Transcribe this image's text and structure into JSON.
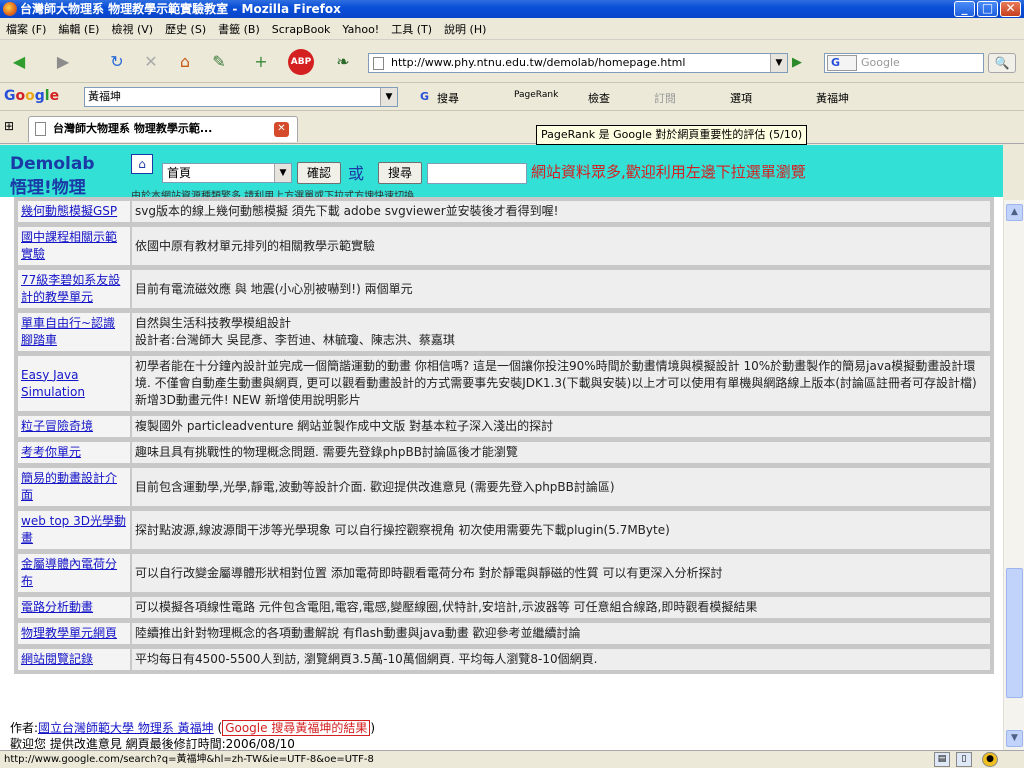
{
  "window": {
    "title": "台灣師大物理系 物理教學示範實驗教室 - Mozilla Firefox",
    "min": "_",
    "max": "□",
    "close": "✕"
  },
  "menu": [
    "檔案 (F)",
    "編輯 (E)",
    "檢視 (V)",
    "歷史 (S)",
    "書籤 (B)",
    "ScrapBook",
    "Yahoo!",
    "工具 (T)",
    "說明 (H)"
  ],
  "nav": {
    "url": "http://www.phy.ntnu.edu.tw/demolab/homepage.html",
    "search_engine": "G",
    "search_placeholder": "Google"
  },
  "google_toolbar": {
    "logo": "Google",
    "query": "黃福坤",
    "search": "搜尋",
    "pagerank": "PageRank",
    "check": "檢查",
    "subscribe": "訂閱",
    "options": "選項",
    "user": "黃福坤"
  },
  "tab": {
    "label": "台灣師大物理系 物理教學示範..."
  },
  "tooltip": "PageRank 是 Google 對於網頁重要性的評估 (5/10)",
  "header": {
    "logo_line1": "Demolab",
    "logo_line2": "悟理!物理",
    "select_value": "首頁",
    "confirm": "確認",
    "or": "或",
    "search": "搜尋",
    "notice": "網站資料眾多,歡迎利用左邊下拉選單瀏覽",
    "sub": "由於本網站資源種類繁多,請利用上方選單或下拉式方塊快速切換"
  },
  "rows": [
    {
      "name": "幾何動態模擬GSP",
      "desc": "svg版本的線上幾何動態模擬 須先下載 adobe svgviewer並安裝後才看得到喔!"
    },
    {
      "name": "國中課程相關示範實驗",
      "desc": "依國中原有教材單元排列的相關教學示範實驗"
    },
    {
      "name": "77級李碧如系友設計的教學單元",
      "desc": "目前有電流磁效應 與 地震(小心別被嚇到!) 兩個單元"
    },
    {
      "name": "單車自由行~認識腳踏車",
      "desc": "自然與生活科技教學模組設計\n設計者:台灣師大 吳昆彥、李哲迪、林毓瓊、陳志洪、蔡嘉琪"
    },
    {
      "name": "Easy Java Simulation",
      "desc": "初學者能在十分鐘內設計並完成一個簡諧運動的動畫 你相信嗎? 這是一個讓你投注90%時間於動畫情境與模擬設計 10%於動畫製作的簡易java模擬動畫設計環境. 不僅會自動產生動畫與網頁, 更可以觀看動畫設計的方式需要事先安裝JDK1.3(下載與安裝)以上才可以使用有單機與網路線上版本(討論區註冊者可存設計檔) 新增3D動畫元件! NEW 新增使用說明影片"
    },
    {
      "name": "粒子冒險奇境",
      "desc": "複製國外 particleadventure 網站並製作成中文版 對基本粒子深入淺出的探討"
    },
    {
      "name": "考考你單元",
      "desc": "趣味且具有挑戰性的物理概念問題. 需要先登錄phpBB討論區後才能瀏覽"
    },
    {
      "name": "簡易的動畫設計介面",
      "desc": "目前包含運動學,光學,靜電,波動等設計介面. 歡迎提供改進意見 (需要先登入phpBB討論區)"
    },
    {
      "name": "web top 3D光學動畫",
      "desc": "探討點波源,線波源間干涉等光學現象 可以自行操控觀察視角 初次使用需要先下載plugin(5.7MByte)"
    },
    {
      "name": "金屬導體內電荷分布",
      "desc": "可以自行改變金屬導體形狀相對位置 添加電荷即時觀看電荷分布 對於靜電與靜磁的性質 可以有更深入分析探討"
    },
    {
      "name": "電路分析動畫",
      "desc": "可以模擬各項線性電路 元件包含電阻,電容,電感,變壓線圈,伏特計,安培計,示波器等 可任意組合線路,即時觀看模擬結果"
    },
    {
      "name": "物理教學單元網頁",
      "desc": "陸續推出針對物理概念的各項動畫解說 有flash動畫與java動畫 歡迎參考並繼續討論"
    },
    {
      "name": "網站閱覽記錄",
      "desc": "平均每日有4500-5500人到訪, 瀏覽網頁3.5萬-10萬個網頁. 平均每人瀏覽8-10個網頁."
    }
  ],
  "footer": {
    "author_label": "作者:",
    "author": "國立台灣師範大學 物理系 黃福坤",
    "google": "Google 搜尋黃福坤的結果",
    "line2": "歡迎您 提供改進意見 網頁最後修訂時間:2006/08/10"
  },
  "status": "http://www.google.com/search?q=黃福坤&hl=zh-TW&ie=UTF-8&oe=UTF-8"
}
